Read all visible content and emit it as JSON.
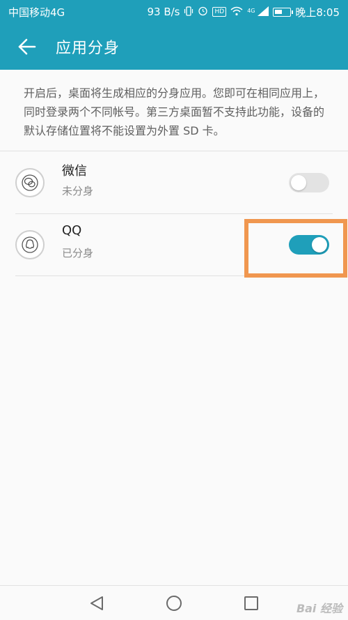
{
  "status_bar": {
    "carrier": "中国移动4G",
    "speed": "93 B/s",
    "hd_label": "HD",
    "signal_label": "4G",
    "time": "晚上8:05"
  },
  "app_bar": {
    "title": "应用分身",
    "back_icon": "arrow-left-icon"
  },
  "description": "开启后，桌面将生成相应的分身应用。您即可在相同应用上，同时登录两个不同帐号。第三方桌面暂不支持此功能，设备的默认存储位置将不能设置为外置 SD 卡。",
  "apps": [
    {
      "name": "微信",
      "status": "未分身",
      "enabled": false,
      "icon": "wechat-icon"
    },
    {
      "name": "QQ",
      "status": "已分身",
      "enabled": true,
      "icon": "qq-icon"
    }
  ],
  "colors": {
    "accent": "#1f9fba",
    "toggle_off": "#e3e3e3",
    "highlight": "#f0974f"
  },
  "nav_bar": {
    "back_icon": "triangle-back-icon",
    "home_icon": "circle-home-icon",
    "recent_icon": "square-recent-icon"
  },
  "watermark": "Bai 经验"
}
